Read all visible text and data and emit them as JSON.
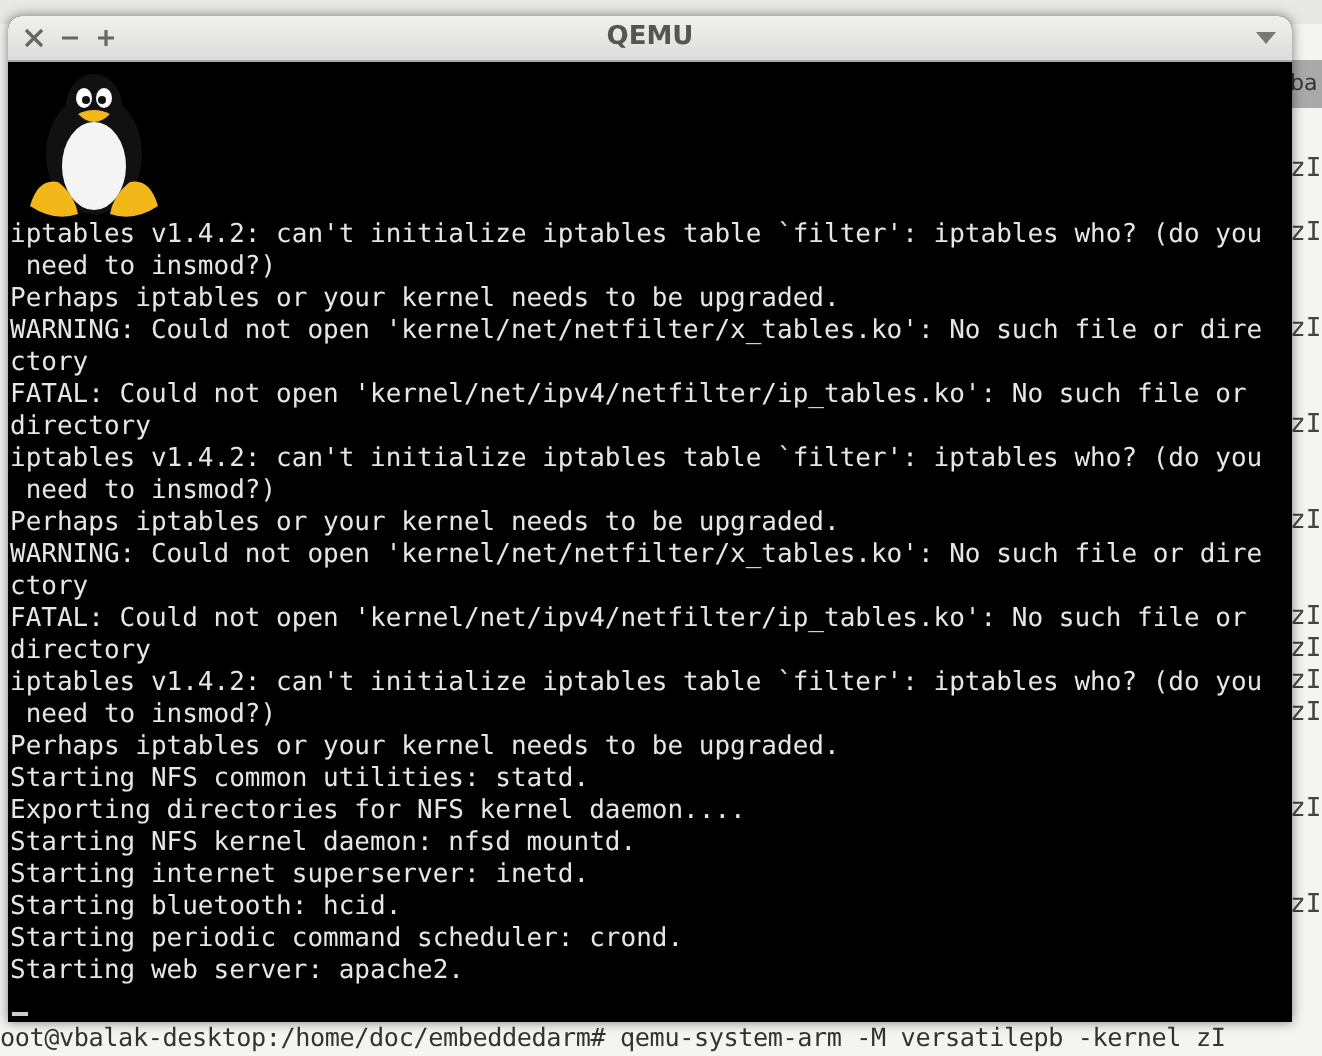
{
  "window": {
    "title": "QEMU"
  },
  "console": {
    "lines": [
      "iptables v1.4.2: can't initialize iptables table `filter': iptables who? (do you",
      " need to insmod?)",
      "Perhaps iptables or your kernel needs to be upgraded.",
      "WARNING: Could not open 'kernel/net/netfilter/x_tables.ko': No such file or dire",
      "ctory",
      "FATAL: Could not open 'kernel/net/ipv4/netfilter/ip_tables.ko': No such file or",
      "directory",
      "iptables v1.4.2: can't initialize iptables table `filter': iptables who? (do you",
      " need to insmod?)",
      "Perhaps iptables or your kernel needs to be upgraded.",
      "WARNING: Could not open 'kernel/net/netfilter/x_tables.ko': No such file or dire",
      "ctory",
      "FATAL: Could not open 'kernel/net/ipv4/netfilter/ip_tables.ko': No such file or",
      "directory",
      "iptables v1.4.2: can't initialize iptables table `filter': iptables who? (do you",
      " need to insmod?)",
      "Perhaps iptables or your kernel needs to be upgraded.",
      "Starting NFS common utilities: statd.",
      "Exporting directories for NFS kernel daemon....",
      "Starting NFS kernel daemon: nfsd mountd.",
      "Starting internet superserver: inetd.",
      "Starting bluetooth: hcid.",
      "Starting periodic command scheduler: crond.",
      "Starting web server: apache2."
    ]
  },
  "background_terminal": {
    "tab": "ba",
    "rows": [
      {
        "kind": "text",
        "text": "zI"
      },
      {
        "kind": "blank"
      },
      {
        "kind": "text",
        "text": "zI"
      },
      {
        "kind": "blank"
      },
      {
        "kind": "blank"
      },
      {
        "kind": "text",
        "text": "zI"
      },
      {
        "kind": "blank"
      },
      {
        "kind": "blank"
      },
      {
        "kind": "text",
        "text": "zI"
      },
      {
        "kind": "blank"
      },
      {
        "kind": "blank"
      },
      {
        "kind": "text",
        "text": "zI"
      },
      {
        "kind": "blank"
      },
      {
        "kind": "blank"
      },
      {
        "kind": "text",
        "text": "zI"
      },
      {
        "kind": "text",
        "text": "zI"
      },
      {
        "kind": "text",
        "text": "zI"
      },
      {
        "kind": "text",
        "text": "zI"
      },
      {
        "kind": "blank"
      },
      {
        "kind": "blank"
      },
      {
        "kind": "text",
        "text": "zI"
      },
      {
        "kind": "blank"
      },
      {
        "kind": "blank"
      },
      {
        "kind": "text",
        "text": "zI"
      }
    ],
    "prompt": "oot@vbalak-desktop:/home/doc/embeddedarm# qemu-system-arm -M versatilepb -kernel zI"
  }
}
